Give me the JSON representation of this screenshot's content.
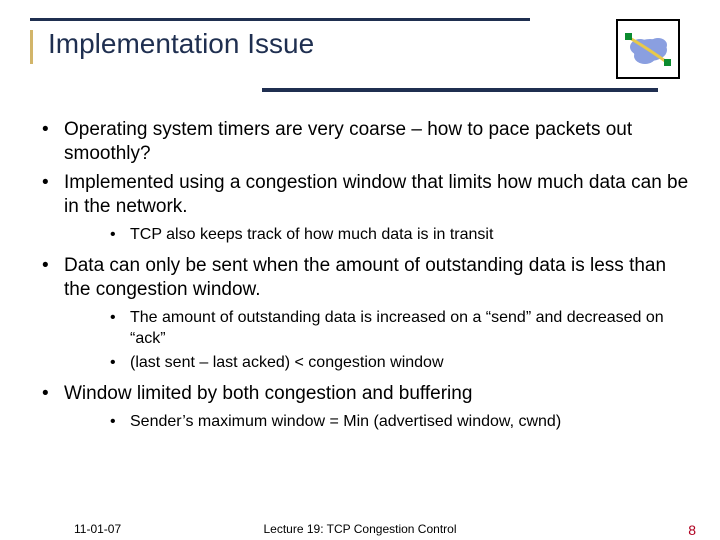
{
  "title": "Implementation Issue",
  "bullets": [
    {
      "text": "Operating system timers are very coarse – how to pace packets out smoothly?"
    },
    {
      "text": "Implemented using a congestion window that limits how much data can be in the network.",
      "sub": [
        "TCP also keeps track of how much data is in transit"
      ]
    },
    {
      "text": "Data can only be sent when the amount of outstanding data is less than the congestion window.",
      "sub": [
        "The amount of outstanding data is increased on a “send” and decreased on “ack”",
        "(last sent – last acked) < congestion window"
      ]
    },
    {
      "text": "Window limited by both congestion and buffering",
      "sub": [
        "Sender’s maximum window = Min (advertised window, cwnd)"
      ]
    }
  ],
  "footer": {
    "date": "11-01-07",
    "lecture": "Lecture 19: TCP Congestion Control",
    "page": "8"
  }
}
